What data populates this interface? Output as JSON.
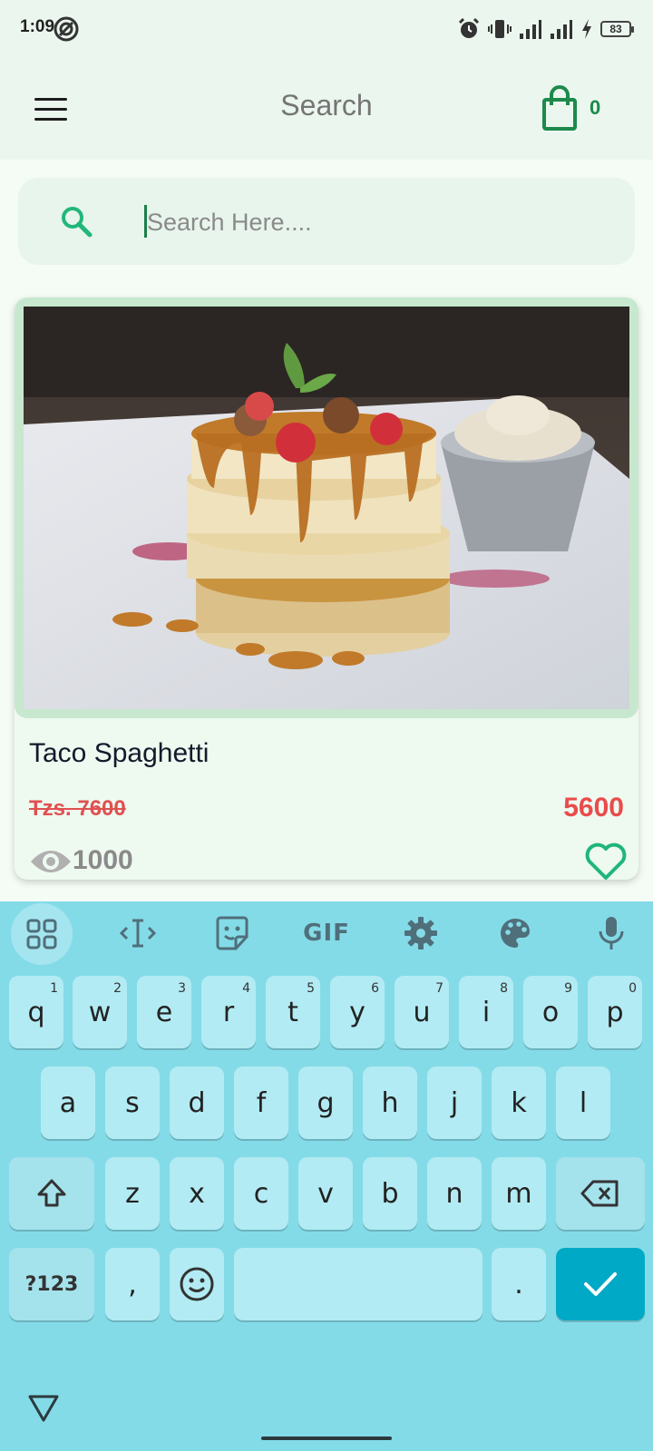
{
  "status_bar": {
    "time": "1:09",
    "battery": "83"
  },
  "app_bar": {
    "title": "Search",
    "cart_count": "0",
    "accent_color": "#1b8a4b"
  },
  "search": {
    "placeholder": "Search Here....",
    "value": ""
  },
  "product": {
    "name": "Taco Spaghetti",
    "old_price": "Tzs. 7600",
    "new_price": "5600",
    "views": "1000",
    "image": "pancakes-icon",
    "favorite": false
  },
  "keyboard": {
    "toolbar": [
      "apps-icon",
      "cursor-icon",
      "sticker-icon",
      "GIF",
      "settings-icon",
      "palette-icon",
      "mic-icon"
    ],
    "row1": [
      {
        "k": "q",
        "h": "1"
      },
      {
        "k": "w",
        "h": "2"
      },
      {
        "k": "e",
        "h": "3"
      },
      {
        "k": "r",
        "h": "4"
      },
      {
        "k": "t",
        "h": "5"
      },
      {
        "k": "y",
        "h": "6"
      },
      {
        "k": "u",
        "h": "7"
      },
      {
        "k": "i",
        "h": "8"
      },
      {
        "k": "o",
        "h": "9"
      },
      {
        "k": "p",
        "h": "0"
      }
    ],
    "row2": [
      "a",
      "s",
      "d",
      "f",
      "g",
      "h",
      "j",
      "k",
      "l"
    ],
    "row3": [
      "z",
      "x",
      "c",
      "v",
      "b",
      "n",
      "m"
    ],
    "symbols_label": "?123",
    "comma": ",",
    "period": ".",
    "enter_color": "#00a9c6"
  }
}
